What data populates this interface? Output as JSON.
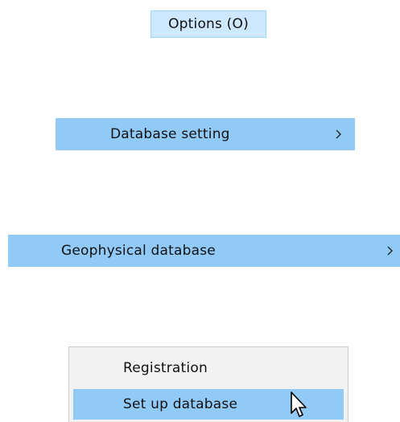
{
  "menu_bar": {
    "options_label": "Options (O)"
  },
  "menu": {
    "database_setting_label": "Database setting",
    "geophysical_database_label": "Geophysical database",
    "submenu_icon": "chevron-right-icon"
  },
  "submenu": {
    "items": [
      {
        "label": "Registration",
        "highlighted": false
      },
      {
        "label": "Set up database",
        "highlighted": true
      }
    ]
  },
  "pointer": {
    "icon": "mouse-pointer-icon"
  },
  "colors": {
    "highlight": "#91c9f7",
    "menu_title_bg": "#cde8ff",
    "menu_title_border": "#99d1ff",
    "submenu_bg": "#f2f2f2",
    "text": "#111111"
  }
}
